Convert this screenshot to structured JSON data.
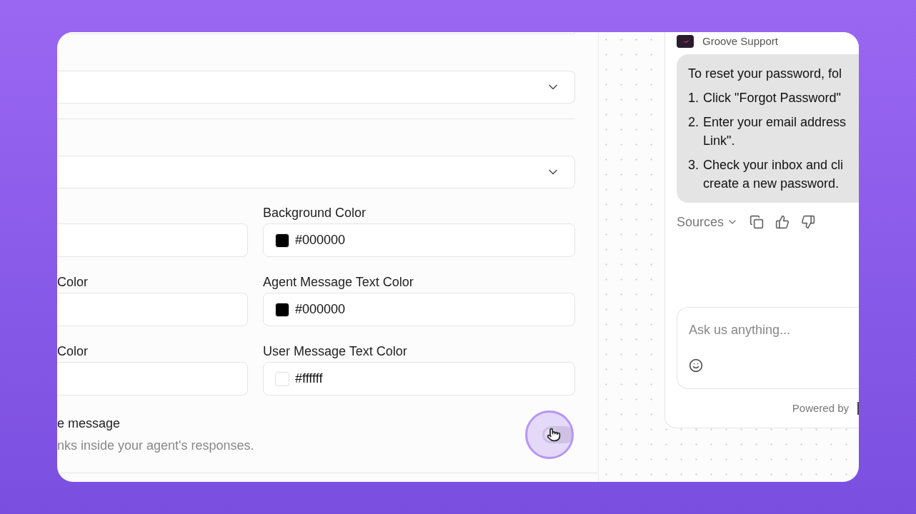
{
  "settings": {
    "rows": [
      {
        "right": {
          "label": "Background Color",
          "value": "#000000",
          "color": "#000000"
        }
      },
      {
        "left": {
          "label": "Color"
        },
        "right": {
          "label": "Agent Message Text Color",
          "value": "#000000",
          "color": "#000000"
        }
      },
      {
        "left": {
          "label": "Color"
        },
        "right": {
          "label": "User Message Text Color",
          "value": "#ffffff",
          "color": "#ffffff"
        }
      }
    ],
    "toggle": {
      "title": "e message",
      "description": "nks inside your agent's responses.",
      "on": false
    }
  },
  "chat": {
    "agent_name": "Groove Support",
    "message": {
      "intro": "To reset your password, fol",
      "steps": [
        {
          "number": "1.",
          "lines": [
            "Click \"Forgot Password\""
          ]
        },
        {
          "number": "2.",
          "lines": [
            "Enter your email address",
            "Link\"."
          ]
        },
        {
          "number": "3.",
          "lines": [
            "Check your inbox and cli",
            "create a new password."
          ]
        }
      ]
    },
    "sources_label": "Sources",
    "input_placeholder": "Ask us anything...",
    "powered_by": "Powered by"
  }
}
